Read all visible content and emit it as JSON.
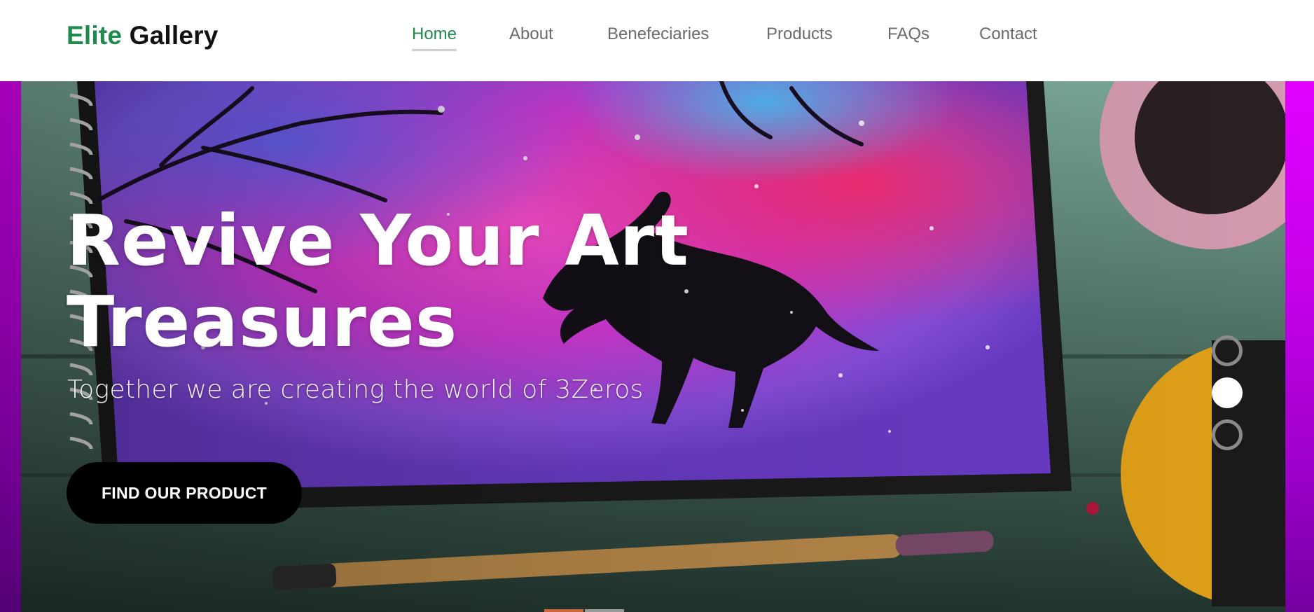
{
  "brand": {
    "accent_text": "Elite",
    "rest_text": " Gallery",
    "accent_color": "#1e8a4c"
  },
  "nav": {
    "items": [
      {
        "label": "Home",
        "active": true
      },
      {
        "label": "About",
        "active": false
      },
      {
        "label": "Benefeciaries",
        "active": false
      },
      {
        "label": "Products",
        "active": false
      },
      {
        "label": "FAQs",
        "active": false
      },
      {
        "label": "Contact",
        "active": false
      }
    ]
  },
  "hero": {
    "title_line1": "Revive Your Art",
    "title_line2": "Treasures",
    "subtitle": "Together we are creating the world of 3Zeros",
    "cta_label": "FIND OUR PRODUCT",
    "slide_count": 3,
    "active_slide": 2
  },
  "colors": {
    "nav_default": "#6b6b6b",
    "nav_active": "#1e8a4c",
    "cta_background": "#000000",
    "hero_side_gradient_top": "#e200ff",
    "hero_side_gradient_bottom": "#7400a0"
  },
  "icons": {
    "slide_dot_inactive": "circle-outline-icon",
    "slide_dot_active": "circle-filled-icon"
  }
}
